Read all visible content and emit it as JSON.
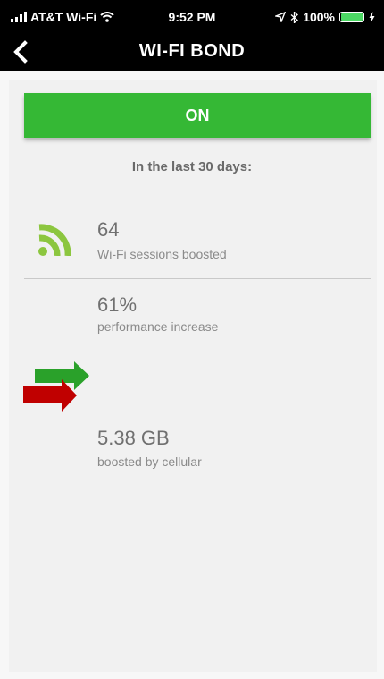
{
  "status_bar": {
    "carrier": "AT&T Wi-Fi",
    "time": "9:52 PM",
    "battery": "100%",
    "battery_color": "#4cd964"
  },
  "header": {
    "title": "WI-FI BOND",
    "back_icon": "chevron-left-icon"
  },
  "toggle": {
    "label": "ON",
    "color": "#35b835"
  },
  "period_label": "In the last 30 days:",
  "stats": {
    "sessions": {
      "value": "64",
      "label": "Wi-Fi sessions boosted",
      "icon": "wifi-signal-icon",
      "icon_color": "#8cc63f"
    },
    "performance": {
      "value": "61%",
      "label": "performance increase"
    },
    "cellular": {
      "value": "5.38 GB",
      "label": "boosted by cellular",
      "icon": "bond-arrows-icon",
      "arrow_colors": [
        "#2aa12a",
        "#c00000"
      ]
    }
  }
}
